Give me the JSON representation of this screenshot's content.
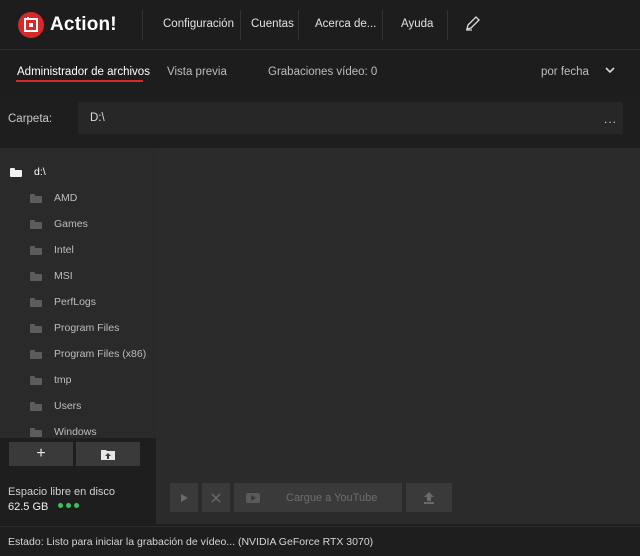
{
  "app": {
    "title": "Action!"
  },
  "menu": {
    "items": [
      {
        "label": "Configuración"
      },
      {
        "label": "Cuentas"
      },
      {
        "label": "Acerca de..."
      },
      {
        "label": "Ayuda"
      }
    ],
    "edit_icon": "pen-icon"
  },
  "tabs": {
    "file_manager": "Administrador de archivos",
    "preview": "Vista previa",
    "recordings_label": "Grabaciones vídeo: 0",
    "sort": "por fecha"
  },
  "folder": {
    "label": "Carpeta:",
    "path": "D:\\",
    "browse": "..."
  },
  "tree": {
    "root": "d:\\",
    "items": [
      {
        "label": "AMD"
      },
      {
        "label": "Games"
      },
      {
        "label": "Intel"
      },
      {
        "label": "MSI"
      },
      {
        "label": "PerfLogs"
      },
      {
        "label": "Program Files"
      },
      {
        "label": "Program Files (x86)"
      },
      {
        "label": "tmp"
      },
      {
        "label": "Users"
      },
      {
        "label": "Windows"
      }
    ],
    "add_label": "+"
  },
  "disk": {
    "label": "Espacio libre en disco",
    "value": "62.5 GB"
  },
  "actions": {
    "upload_youtube": "Cargue a YouTube"
  },
  "status": {
    "text": "Estado:  Listo para iniciar la grabación de vídeo...  (NVIDIA GeForce RTX 3070)"
  },
  "colors": {
    "accent": "#d42a2a",
    "disk_ok": "#3fbf5f"
  }
}
